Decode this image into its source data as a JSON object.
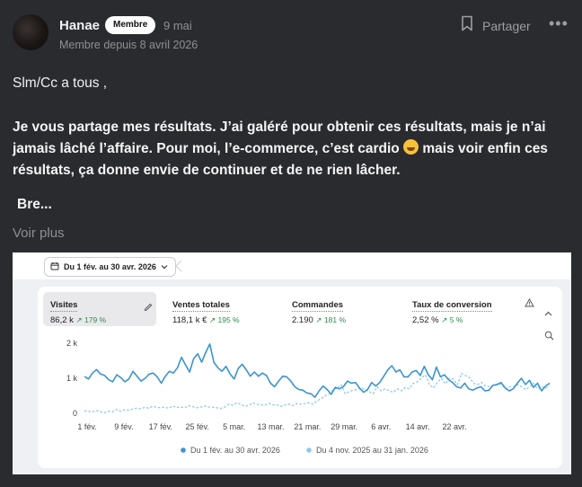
{
  "post": {
    "author": "Hanae",
    "badge": "Membre",
    "date": "9 mai",
    "member_since": "Membre depuis 8 avril 2026",
    "share_label": "Partager",
    "more_glyph": "•••",
    "greeting": "Slm/Cc a tous ,",
    "body_part1": "Je vous partage mes résultats. J’ai galéré pour obtenir  ces résultats, mais je n’ai jamais lâché l’affaire. Pour moi, l’e-commerce, c’est  cardio",
    "body_part2": " mais voir enfin ces résultats, ça donne envie de continuer et de ne rien lâcher.",
    "truncated": "Bre...",
    "see_more": "Voir plus"
  },
  "screenshot": {
    "date_range": "Du 1 fév. au 30 avr. 2026",
    "metrics": [
      {
        "label": "Visites",
        "value": "86,2 k",
        "change": "↗ 179 %"
      },
      {
        "label": "Ventes totales",
        "value": "118,1 k €",
        "change": "↗ 195 %"
      },
      {
        "label": "Commandes",
        "value": "2.190",
        "change": "↗ 181 %"
      },
      {
        "label": "Taux de conversion",
        "value": "2,52 %",
        "change": "↗ 5 %"
      }
    ]
  },
  "colors": {
    "current": "#3b94d0",
    "previous": "#8ec9ea",
    "positive": "#2e8a4a"
  },
  "chart_data": {
    "type": "line",
    "x_ticks": [
      "1 fév.",
      "9 fév.",
      "17 fév.",
      "25 fév.",
      "5 mar.",
      "13 mar.",
      "21 mar.",
      "29 mar.",
      "6 avr.",
      "14 avr.",
      "22 avr."
    ],
    "y_ticks": [
      "2 k",
      "1 k",
      "0"
    ],
    "ylim": [
      0,
      2000
    ],
    "series": [
      {
        "name": "Du 1 fév. au 30 avr. 2026",
        "style": "solid",
        "values": [
          1050,
          980,
          1150,
          1250,
          1120,
          1080,
          960,
          900,
          1100,
          1020,
          900,
          980,
          1200,
          1060,
          920,
          1000,
          1120,
          1150,
          1040,
          860,
          1060,
          1200,
          1150,
          1300,
          1600,
          1380,
          1180,
          1560,
          1700,
          1460,
          1740,
          1980,
          1460,
          1300,
          1200,
          1340,
          1120,
          980,
          1280,
          1400,
          1240,
          1060,
          1180,
          1060,
          1150,
          1080,
          860,
          760,
          920,
          1060,
          1040,
          920,
          760,
          680,
          660,
          580,
          560,
          460,
          640,
          780,
          680,
          540,
          740,
          700,
          760,
          920,
          860,
          880,
          720,
          600,
          680,
          880,
          780,
          880,
          1060,
          1240,
          1360,
          1180,
          1240,
          1040,
          1040,
          1180,
          1220,
          1080,
          1340,
          1100,
          960,
          1320,
          1040,
          1100,
          960,
          880,
          760,
          720,
          860,
          700,
          660,
          720,
          760,
          640,
          660,
          800,
          820,
          880,
          720,
          640,
          700,
          860,
          1000,
          820,
          940,
          740,
          860,
          640,
          780,
          860
        ]
      },
      {
        "name": "Du 4 nov. 2025 au 31 jan. 2026",
        "style": "dashed",
        "values": [
          70,
          60,
          40,
          80,
          50,
          20,
          60,
          40,
          110,
          60,
          100,
          90,
          120,
          150,
          130,
          170,
          150,
          200,
          170,
          160,
          180,
          140,
          210,
          170,
          180,
          160,
          220,
          190,
          160,
          180,
          210,
          180,
          170,
          160,
          140,
          180,
          260,
          230,
          300,
          260,
          200,
          230,
          300,
          260,
          240,
          240,
          280,
          240,
          240,
          200,
          240,
          260,
          220,
          280,
          260,
          280,
          300,
          260,
          360,
          420,
          500,
          560,
          680,
          720,
          820,
          560,
          620,
          660,
          680,
          720,
          680,
          620,
          560,
          760,
          640,
          700,
          640,
          600,
          700,
          640,
          740,
          700,
          860,
          900,
          1000,
          1100,
          820,
          720,
          880,
          1000,
          840,
          1000,
          980,
          820,
          1140,
          1080,
          1020,
          860,
          820,
          880,
          780,
          760,
          800,
          840,
          820,
          700,
          760,
          760,
          820,
          760,
          680,
          760,
          860,
          700,
          760,
          720,
          780
        ]
      }
    ],
    "legend": "bottom-center",
    "grid": false
  }
}
